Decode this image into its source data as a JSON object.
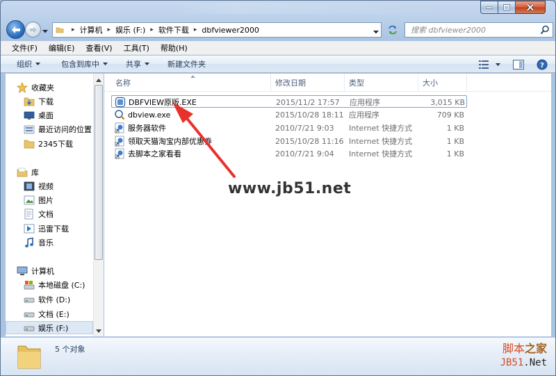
{
  "breadcrumb": {
    "items": [
      "计算机",
      "娱乐 (F:)",
      "软件下载",
      "dbfviewer2000"
    ]
  },
  "search": {
    "placeholder": "搜索 dbfviewer2000"
  },
  "menu": {
    "items": [
      "文件(F)",
      "编辑(E)",
      "查看(V)",
      "工具(T)",
      "帮助(H)"
    ]
  },
  "toolbar": {
    "organize": "组织",
    "include_library": "包含到库中",
    "share": "共享",
    "new_folder": "新建文件夹"
  },
  "nav": {
    "favorites_header": "收藏夹",
    "favorites": [
      "下载",
      "桌面",
      "最近访问的位置",
      "2345下载"
    ],
    "libraries_header": "库",
    "libraries": [
      "视频",
      "图片",
      "文档",
      "迅雷下载",
      "音乐"
    ],
    "computer_header": "计算机",
    "drives": [
      "本地磁盘 (C:)",
      "软件 (D:)",
      "文档 (E:)",
      "娱乐 (F:)"
    ]
  },
  "columns": {
    "name": "名称",
    "modified": "修改日期",
    "type": "类型",
    "size": "大小"
  },
  "files": [
    {
      "name": "DBFVIEW原版.EXE",
      "modified": "2015/11/2 17:57",
      "type": "应用程序",
      "size": "3,015 KB",
      "icon": "app-icon"
    },
    {
      "name": "dbview.exe",
      "modified": "2015/10/28 18:11",
      "type": "应用程序",
      "size": "709 KB",
      "icon": "app-icon"
    },
    {
      "name": "服务器软件",
      "modified": "2010/7/21 9:03",
      "type": "Internet 快捷方式",
      "size": "1 KB",
      "icon": "shortcut-icon"
    },
    {
      "name": "领取天猫淘宝内部优惠券",
      "modified": "2015/10/28 11:16",
      "type": "Internet 快捷方式",
      "size": "1 KB",
      "icon": "shortcut-icon"
    },
    {
      "name": "去脚本之家看看",
      "modified": "2010/7/21 9:04",
      "type": "Internet 快捷方式",
      "size": "1 KB",
      "icon": "shortcut-icon"
    }
  ],
  "watermark": "www.jb51.net",
  "details": {
    "count": "5 个对象"
  },
  "brand": {
    "cn_main": "脚本",
    "cn_accent": "之家",
    "en_main": "JB51",
    "en_accent": ".Net"
  },
  "colors": {
    "accent": "#1e395b",
    "selection": "#7da2ce",
    "arrow": "#e8312b"
  }
}
